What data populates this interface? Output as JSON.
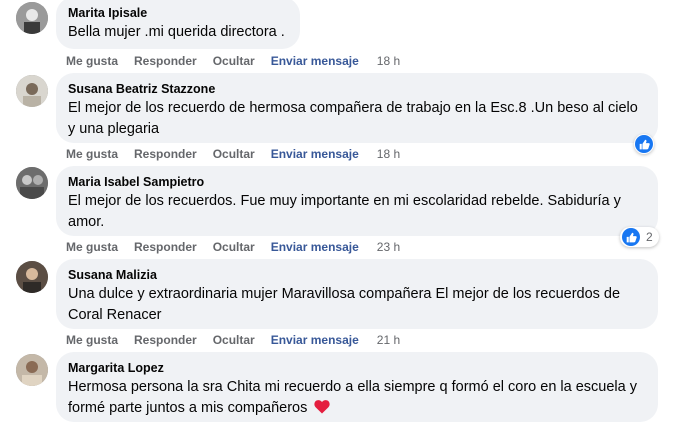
{
  "actions": {
    "like": "Me gusta",
    "reply": "Responder",
    "hide": "Ocultar",
    "send": "Enviar mensaje"
  },
  "colors": {
    "like_blue": "#1877f2",
    "link_blue": "#385898",
    "heart_red": "#e41e3f"
  },
  "comments": [
    {
      "author": "Marita Ipisale",
      "lines": [
        "Bella mujer .mi querida directora ."
      ],
      "time": "18 h",
      "reactions": null
    },
    {
      "author": "Susana Beatriz Stazzone",
      "lines": [
        "El mejor de los recuerdo de hermosa compañera de trabajo en la Esc.8 .Un beso al cielo",
        "y una plegaria"
      ],
      "time": "18 h",
      "reactions": {
        "icon": "like-icon",
        "count": ""
      }
    },
    {
      "author": "Maria Isabel Sampietro",
      "lines": [
        "El mejor de los recuerdos. Fue muy importante en mi escolaridad rebelde. Sabiduría y",
        "amor."
      ],
      "time": "23 h",
      "reactions": {
        "icon": "like-icon",
        "count": "2"
      }
    },
    {
      "author": "Susana Malizia",
      "lines": [
        "Una dulce y extraordinaria mujer Maravillosa compañera El mejor de los recuerdos de",
        "Coral Renacer"
      ],
      "time": "21 h",
      "reactions": null
    },
    {
      "author": "Margarita Lopez",
      "lines": [
        "Hermosa persona la sra Chita mi recuerdo a ella siempre q formó el coro en la escuela y",
        "formé parte juntos a mis compañeros"
      ],
      "time": "",
      "reactions": null,
      "emoji": "red-heart"
    }
  ]
}
